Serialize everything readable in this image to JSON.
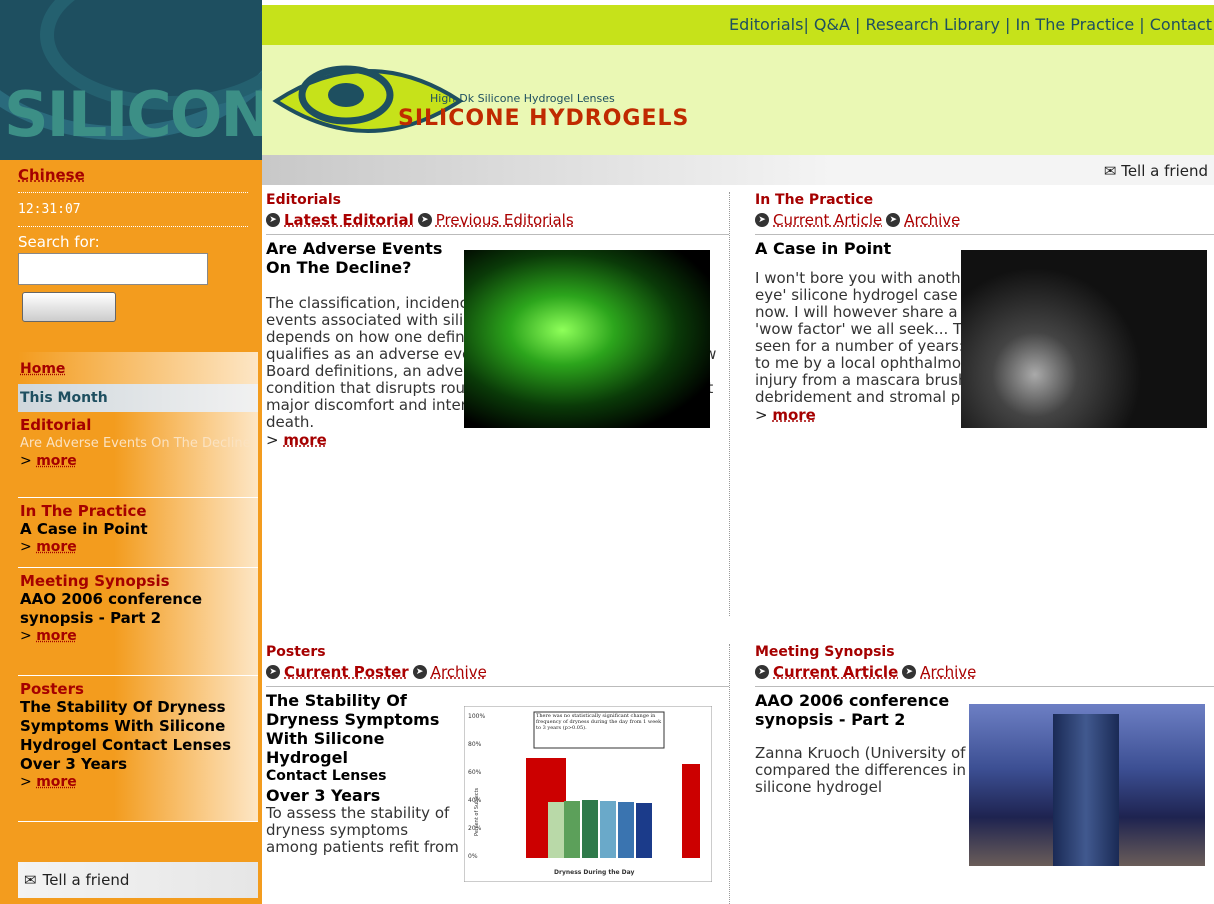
{
  "sidebar": {
    "language_link": "Chinese",
    "clock": "12:31:07",
    "search_label": "Search for:",
    "search_placeholder": "",
    "search_button": "",
    "nav": {
      "home": "Home",
      "this_month": "This Month",
      "sections": [
        {
          "heading": "Editorial",
          "title": "Are Adverse Events On The Decline",
          "more_prefix": "> ",
          "more": "more"
        },
        {
          "heading": "In The Practice",
          "title": "A Case in Point",
          "more_prefix": "> ",
          "more": "more"
        },
        {
          "heading": "Meeting Synopsis",
          "title": "AAO 2006 conference synopsis - Part 2",
          "more_prefix": "> ",
          "more": "more"
        },
        {
          "heading": "Posters",
          "title": "The Stability Of Dryness Symptoms With Silicone Hydrogel Contact Lenses Over 3 Years",
          "more_prefix": "> ",
          "more": "more"
        }
      ]
    },
    "tell_friend": "Tell a friend"
  },
  "header": {
    "nav_items": [
      "Editorials",
      "Q&A",
      "Research Library",
      "In The Practice",
      "Contact"
    ],
    "tagline": "High-Dk Silicone Hydrogel Lenses",
    "brand": "SILICONE HYDROGELS",
    "tell_friend": "Tell a friend"
  },
  "panels": {
    "editorials": {
      "category": "Editorials",
      "link_current": "Latest Editorial",
      "link_other": "Previous Editorials",
      "title": "Are Adverse Events On The Decline?",
      "body": "The classification, incidence, and prevalence of adverse events associated with silicone hydrogel contact lens wear depends on how one defines an adverse event. What qualifies as an adverse event? By some Institutional Review Board definitions, an adverse event can range from any condition that disrupts routine daily living activities without major discomfort and interferences that do not persist, to death.",
      "more_prefix": "> ",
      "more": "more"
    },
    "practice": {
      "category": "In The Practice",
      "link_current": "Current Article",
      "link_other": "Archive",
      "title": "A Case in Point",
      "body": "I won't bore you with another 'myopia reduction' or 'white eye' silicone hydrogel case as these are rather passé by now. I will however share a case where we do have that 'wow factor' we all seek... This concerns a lady whom I've seen for a number of years: A high myope, she was referred to me by a local ophthalmologist with a history of corneal injury from a mascara brush followed by epithelial debridement and stromal puncture.",
      "more_prefix": "> ",
      "more": "more"
    },
    "posters": {
      "category": "Posters",
      "link_current": "Current Poster",
      "link_other": "Archive",
      "title_a": "The Stability Of Dryness Symptoms With Silicone Hydrogel",
      "title_b": "Contact Lenses",
      "title_c": "Over 3 Years",
      "body": "To assess the stability of dryness symptoms among patients refit from"
    },
    "meeting": {
      "category": "Meeting Synopsis",
      "link_current": "Current Article",
      "link_other": "Archive",
      "title": "AAO 2006 conference synopsis - Part 2",
      "body": "Zanna Kruoch (University of Houston) and colleagues compared the differences in tear exchange beneath various silicone hydrogel"
    }
  },
  "poster_chart": {
    "note": "There was no statistically significant change in frequency of dryness during the day from 1 week to 3 years (p>0.05).",
    "ylabel": "Percent of Subjects",
    "xlabel": "Dryness During the Day",
    "yticks": [
      "100%",
      "80%",
      "60%",
      "40%",
      "20%",
      "0%"
    ]
  },
  "colors": {
    "orange": "#f39c1e",
    "teal": "#1e4f60",
    "lime": "#c6e21a",
    "dark_red": "#a50000"
  }
}
